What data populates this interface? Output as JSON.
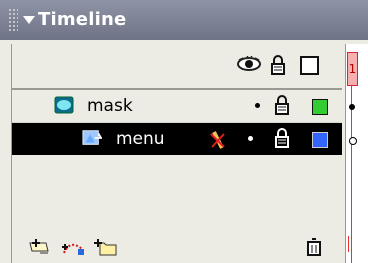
{
  "panel": {
    "title": "Timeline"
  },
  "layers": [
    {
      "name": "mask",
      "color": "#33cc33",
      "selected": false,
      "icon": "mask-layer-icon"
    },
    {
      "name": "menu",
      "color": "#3366ff",
      "selected": true,
      "icon": "masked-layer-icon"
    }
  ],
  "frames": {
    "current": "1"
  },
  "colors": {
    "titlebar": "#7a7f92",
    "selection": "#000000",
    "playhead": "#e33333"
  }
}
